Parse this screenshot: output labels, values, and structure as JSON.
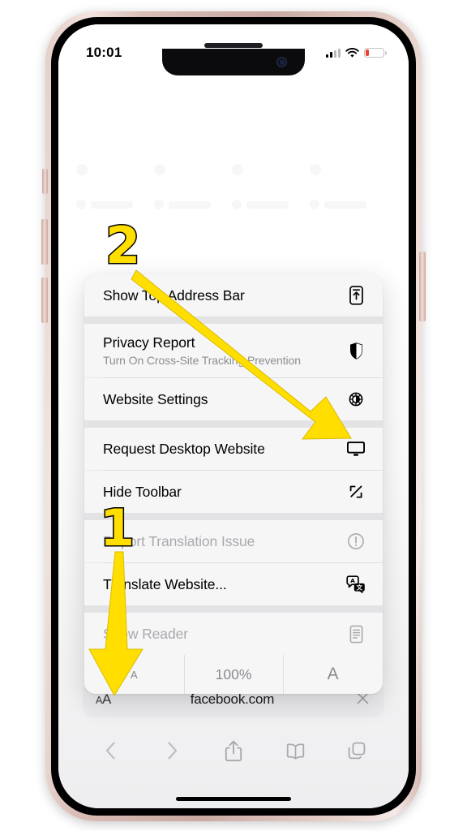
{
  "device": {
    "model_frame": "iphone",
    "frame_color": "#e0c3bc",
    "buttons": [
      "silent-switch",
      "volume-up",
      "volume-down",
      "power"
    ]
  },
  "status_bar": {
    "time": "10:01",
    "cellular_icon": "signal-bars-icon",
    "wifi_icon": "wifi-icon",
    "battery_icon": "battery-low-icon",
    "battery_color": "#f03e2f"
  },
  "browser": {
    "name": "Safari",
    "address_bar": {
      "format_label": "AA",
      "format_label_small": "A",
      "format_label_large": "A",
      "url": "facebook.com",
      "clear_icon": "close-x-icon"
    },
    "toolbar": [
      {
        "name": "back-button",
        "icon": "chevron-left-icon",
        "enabled": false
      },
      {
        "name": "forward-button",
        "icon": "chevron-right-icon",
        "enabled": false
      },
      {
        "name": "share-button",
        "icon": "share-up-arrow-icon",
        "enabled": true
      },
      {
        "name": "bookmarks-button",
        "icon": "book-icon",
        "enabled": true
      },
      {
        "name": "tabs-button",
        "icon": "tabs-squares-icon",
        "enabled": true
      }
    ]
  },
  "menu": {
    "groups": [
      {
        "rows": [
          {
            "label": "Show Top Address Bar",
            "sub": "",
            "icon": "phone-up-arrow-icon",
            "dimmed": false,
            "name": "menu-item-show-top-address-bar"
          }
        ]
      },
      {
        "rows": [
          {
            "label": "Privacy Report",
            "sub": "Turn On Cross-Site Tracking Prevention",
            "icon": "shield-half-icon",
            "dimmed": false,
            "name": "menu-item-privacy-report"
          },
          {
            "label": "Website Settings",
            "sub": "",
            "icon": "gear-icon",
            "dimmed": false,
            "name": "menu-item-website-settings"
          }
        ]
      },
      {
        "rows": [
          {
            "label": "Request Desktop Website",
            "sub": "",
            "icon": "desktop-monitor-icon",
            "dimmed": false,
            "name": "menu-item-request-desktop-website"
          },
          {
            "label": "Hide Toolbar",
            "sub": "",
            "icon": "expand-diagonal-arrows-icon",
            "dimmed": false,
            "name": "menu-item-hide-toolbar"
          }
        ]
      },
      {
        "rows": [
          {
            "label": "Report Translation Issue",
            "sub": "",
            "icon": "exclamation-circle-icon",
            "dimmed": true,
            "name": "menu-item-report-translation-issue"
          },
          {
            "label": "Translate Website...",
            "sub": "",
            "icon": "translate-bubbles-icon",
            "dimmed": false,
            "name": "menu-item-translate-website"
          }
        ]
      },
      {
        "rows": [
          {
            "label": "Show Reader",
            "sub": "",
            "icon": "reader-document-icon",
            "dimmed": true,
            "name": "menu-item-show-reader"
          }
        ]
      }
    ],
    "zoom_row": {
      "decrease_label": "A",
      "value": "100%",
      "increase_label": "A"
    }
  },
  "annotations": {
    "color": "#ffde00",
    "outline": "#000000",
    "markers": [
      {
        "label": "1",
        "points_to": "AA format button in address bar"
      },
      {
        "label": "2",
        "points_to": "Request Desktop Website monitor icon"
      }
    ]
  }
}
